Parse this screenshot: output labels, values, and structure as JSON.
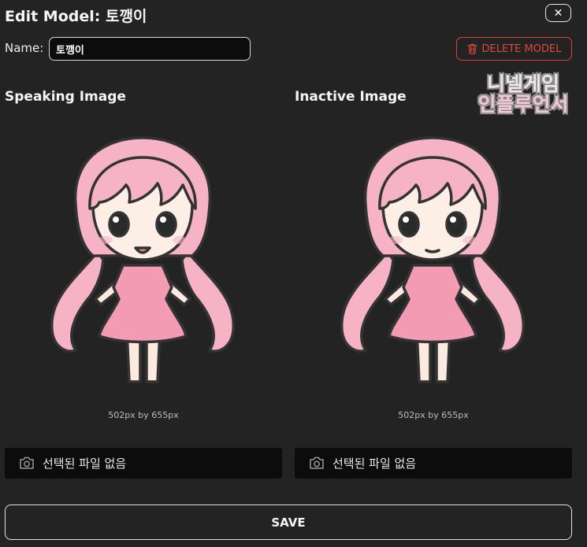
{
  "header": {
    "title": "Edit Model: 토깽이",
    "close_label": "✕"
  },
  "name_field": {
    "label": "Name:",
    "value": "토깽이"
  },
  "delete_button": {
    "label": "DELETE MODEL"
  },
  "speaking": {
    "title": "Speaking Image",
    "dimensions": "502px by 655px",
    "file_label": "선택된 파일 없음"
  },
  "inactive": {
    "title": "Inactive Image",
    "dimensions": "502px by 655px",
    "file_label": "선택된 파일 없음"
  },
  "watermark": {
    "line1": "니넬게임",
    "line2": "인플루언서"
  },
  "save_button": {
    "label": "SAVE"
  },
  "colors": {
    "background": "#232323",
    "danger": "#e0463f",
    "input_bg": "#0c0c0c",
    "hair": "#f6b3c6",
    "dress": "#f49bb4"
  }
}
